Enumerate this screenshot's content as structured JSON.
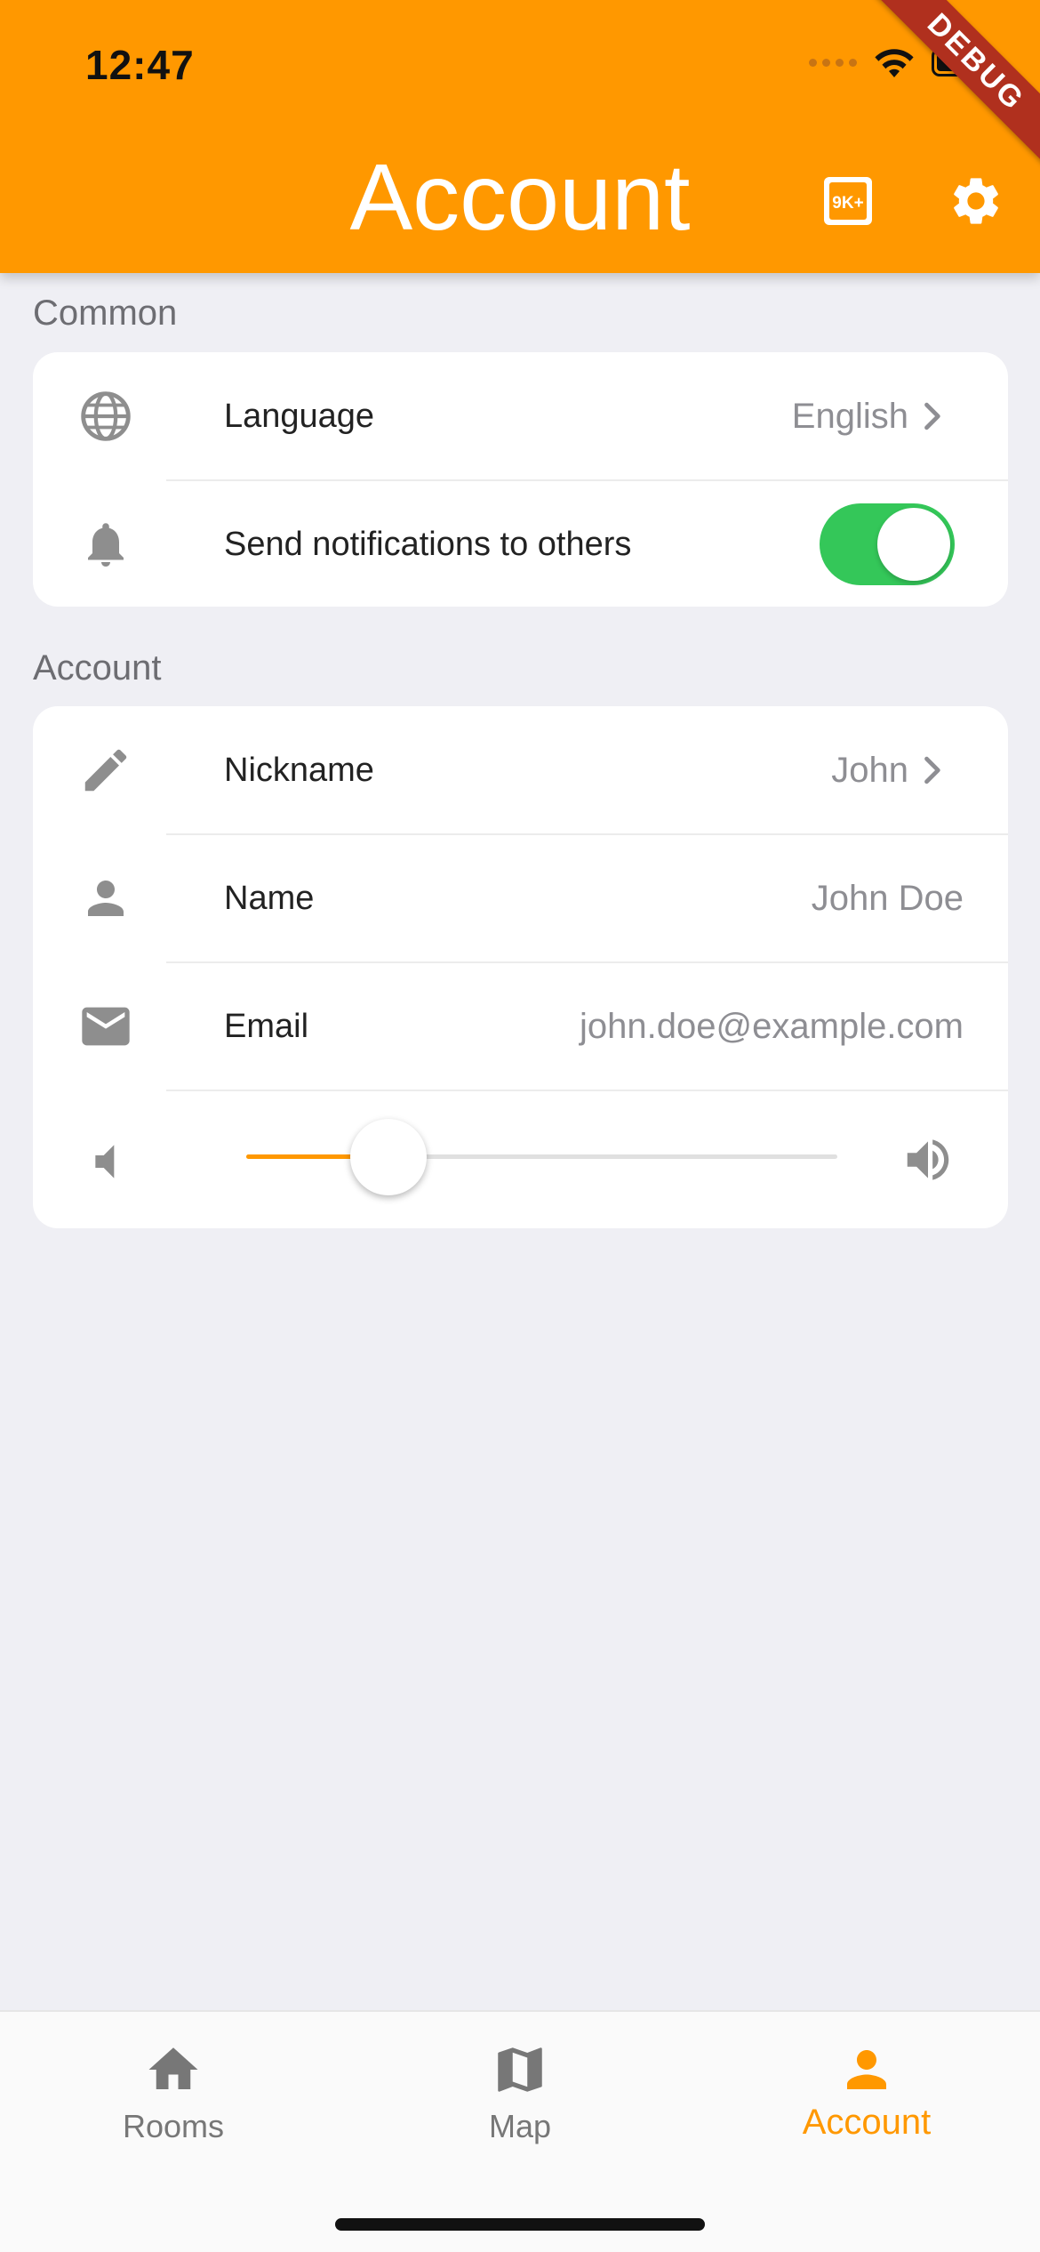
{
  "status_bar": {
    "time": "12:47"
  },
  "debug_banner": "DEBUG",
  "header": {
    "title": "Account",
    "badge_icon": "9k-plus-icon",
    "settings_icon": "gear-icon"
  },
  "sections": {
    "common": {
      "label": "Common",
      "language": {
        "label": "Language",
        "value": "English"
      },
      "notifications": {
        "label": "Send notifications to others",
        "enabled": true
      }
    },
    "account": {
      "label": "Account",
      "nickname": {
        "label": "Nickname",
        "value": "John"
      },
      "name": {
        "label": "Name",
        "value": "John Doe"
      },
      "email": {
        "label": "Email",
        "value": "john.doe@example.com"
      },
      "volume": {
        "level": 0.24
      }
    }
  },
  "bottom_nav": {
    "items": [
      {
        "label": "Rooms",
        "icon": "home-icon",
        "active": false
      },
      {
        "label": "Map",
        "icon": "map-icon",
        "active": false
      },
      {
        "label": "Account",
        "icon": "person-icon",
        "active": true
      }
    ]
  },
  "colors": {
    "accent": "#ff9800",
    "toggle_on": "#34c759",
    "background": "#efeff4"
  }
}
